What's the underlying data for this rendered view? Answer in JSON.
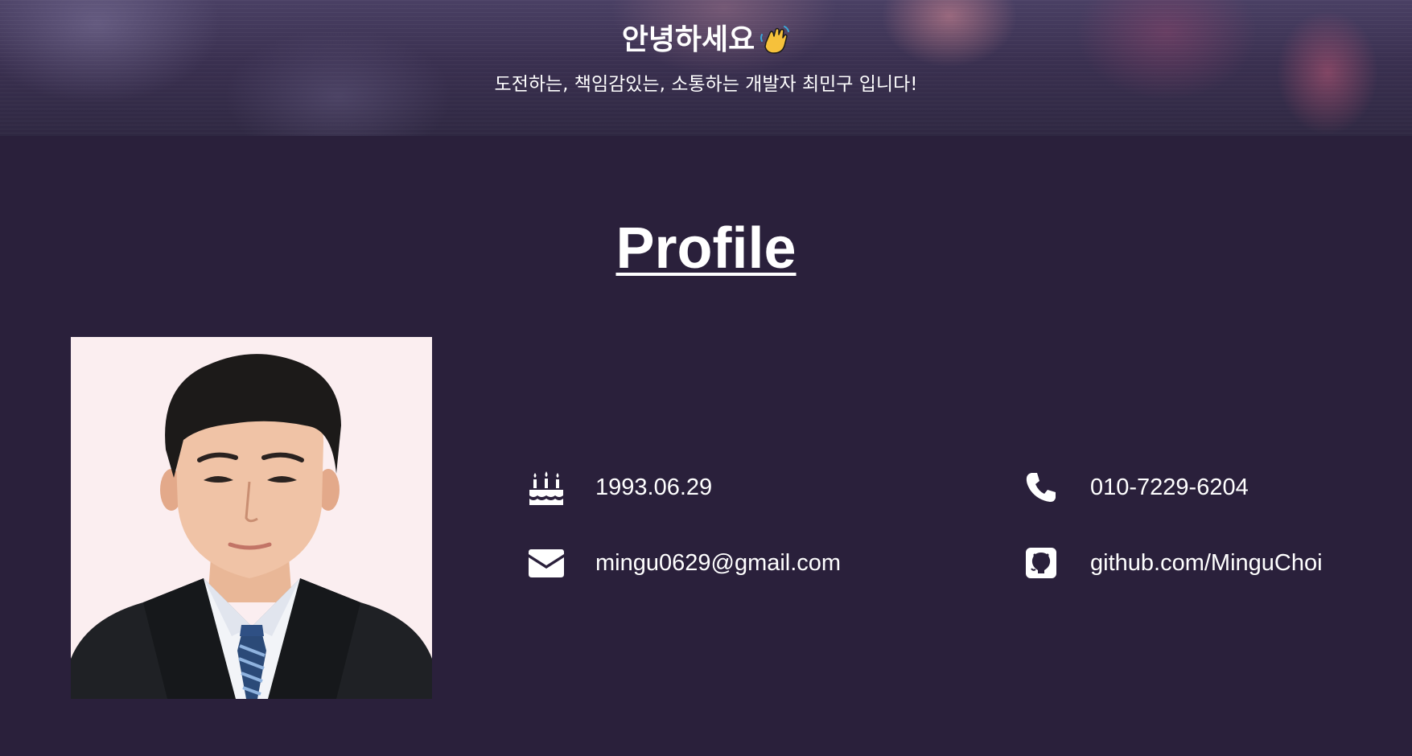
{
  "hero": {
    "greeting": "안녕하세요",
    "greeting_emoji": "waving-hand-icon",
    "subtitle": "도전하는, 책임감있는, 소통하는 개발자 최민구 입니다!"
  },
  "profile": {
    "title": "Profile",
    "photo": "profile-photo",
    "items": [
      {
        "icon": "birthday-cake-icon",
        "text": "1993.06.29"
      },
      {
        "icon": "phone-icon",
        "text": "010-7229-6204"
      },
      {
        "icon": "envelope-icon",
        "text": "mingu0629@gmail.com"
      },
      {
        "icon": "github-icon",
        "text": "github.com/MinguChoi"
      }
    ]
  },
  "colors": {
    "background": "#2a203b",
    "text": "#ffffff",
    "photo_background": "#fbeef0"
  }
}
